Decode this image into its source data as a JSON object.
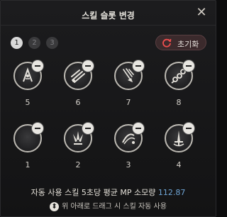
{
  "header": {
    "title": "스킬 슬롯 변경"
  },
  "pages": [
    {
      "label": "1",
      "active": true
    },
    {
      "label": "2",
      "active": false
    },
    {
      "label": "3",
      "active": false
    }
  ],
  "reset": {
    "label": "초기화"
  },
  "slots": [
    {
      "number": "5",
      "icon": "dual-blades-skill-icon"
    },
    {
      "number": "6",
      "icon": "thrown-daggers-skill-icon"
    },
    {
      "number": "7",
      "icon": "falling-strike-skill-icon"
    },
    {
      "number": "8",
      "icon": "chain-links-skill-icon"
    },
    {
      "number": "1",
      "icon": "crescent-moon-skill-icon"
    },
    {
      "number": "2",
      "icon": "blade-burst-skill-icon"
    },
    {
      "number": "3",
      "icon": "slash-wave-skill-icon"
    },
    {
      "number": "4",
      "icon": "upright-sword-skill-icon"
    }
  ],
  "footer": {
    "mp_label": "자동 사용 스킬 5초당 평균 MP 소모량",
    "mp_value": "112.87",
    "hint": "위 아래로 드래그 시 스킬 자동 사용"
  },
  "colors": {
    "accent_blue": "#6fa5d6",
    "reset_bg": "#3b2a2c"
  }
}
